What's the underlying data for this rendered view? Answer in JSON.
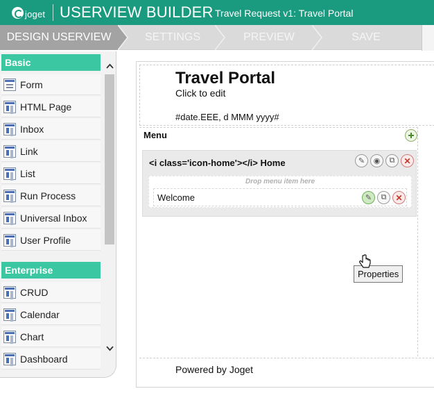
{
  "header": {
    "logo_text": "joget",
    "title": "USERVIEW BUILDER",
    "subtitle": "Travel Request v1: Travel Portal"
  },
  "steps": [
    {
      "label": "DESIGN USERVIEW",
      "active": true
    },
    {
      "label": "SETTINGS",
      "active": false
    },
    {
      "label": "PREVIEW",
      "active": false
    },
    {
      "label": "SAVE",
      "active": false
    }
  ],
  "palette": {
    "groups": [
      {
        "label": "Basic",
        "items": [
          {
            "label": "Form",
            "icon": "form-icon"
          },
          {
            "label": "HTML Page",
            "icon": "html-page-icon"
          },
          {
            "label": "Inbox",
            "icon": "inbox-icon"
          },
          {
            "label": "Link",
            "icon": "link-icon"
          },
          {
            "label": "List",
            "icon": "list-icon"
          },
          {
            "label": "Run Process",
            "icon": "run-process-icon"
          },
          {
            "label": "Universal Inbox",
            "icon": "universal-inbox-icon"
          },
          {
            "label": "User Profile",
            "icon": "user-profile-icon"
          }
        ]
      },
      {
        "label": "Enterprise",
        "items": [
          {
            "label": "CRUD",
            "icon": "crud-icon"
          },
          {
            "label": "Calendar",
            "icon": "calendar-icon"
          },
          {
            "label": "Chart",
            "icon": "chart-icon"
          },
          {
            "label": "Dashboard",
            "icon": "dashboard-icon"
          }
        ]
      }
    ]
  },
  "canvas": {
    "portal_title": "Travel Portal",
    "click_to_edit": "Click to edit",
    "date_format": "#date.EEE, d MMM yyyy#",
    "menu_label": "Menu",
    "category": {
      "title": "<i class='icon-home'></i> Home",
      "drop_hint": "Drop menu item here",
      "items": [
        {
          "label": "Welcome"
        }
      ]
    },
    "tooltip": "Properties",
    "footer": "Powered by Joget"
  },
  "colors": {
    "header_bg": "#1a9a7f",
    "palette_group_bg": "#3cc7a3",
    "active_step_bg": "#a3a3a3"
  }
}
